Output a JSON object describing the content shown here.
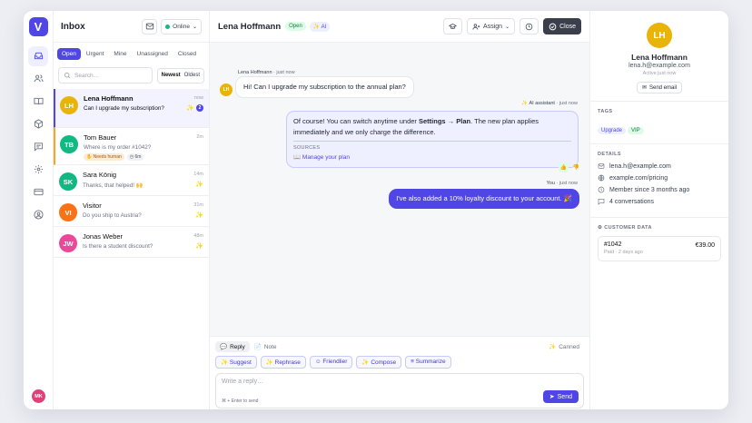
{
  "rail": {
    "logo": "V",
    "avatar": "MK",
    "icons": [
      "inbox-icon",
      "users-icon",
      "book-icon",
      "cube-icon",
      "chat-icon",
      "gear-icon",
      "card-icon",
      "user-circle-icon"
    ]
  },
  "list": {
    "title": "Inbox",
    "status": "Online",
    "tabs": [
      "Open",
      "Urgent",
      "Mine",
      "Unassigned",
      "Closed"
    ],
    "search_placeholder": "Search…",
    "sort": [
      "Newest",
      "Oldest"
    ],
    "conversations": [
      {
        "initials": "LH",
        "name": "Lena Hoffmann",
        "preview": "Can I upgrade my subscription?",
        "time": "now",
        "badge": "2",
        "color": "#eab308"
      },
      {
        "initials": "TB",
        "name": "Tom Bauer",
        "preview": "Where is my order #1042?",
        "time": "2m",
        "tag1": "Needs human",
        "tag2": "6m",
        "color": "#10b981"
      },
      {
        "initials": "SK",
        "name": "Sara König",
        "preview": "Thanks, that helped! 🙌",
        "time": "14m",
        "color": "#10b981"
      },
      {
        "initials": "VI",
        "name": "Visitor",
        "preview": "Do you ship to Austria?",
        "time": "31m",
        "color": "#f97316"
      },
      {
        "initials": "JW",
        "name": "Jonas Weber",
        "preview": "Is there a student discount?",
        "time": "48m",
        "color": "#ec4899"
      }
    ]
  },
  "chat": {
    "name": "Lena Hoffmann",
    "status": "Open",
    "ai_tag": "AI",
    "assign": "Assign",
    "close": "Close",
    "m1_author": "Lena Hoffmann",
    "m1_time": "just now",
    "m1_avatar": "LH",
    "m1_text": "Hi! Can I upgrade my subscription to the annual plan?",
    "m2_author": "AI assistant",
    "m2_time": "just now",
    "m2_pre": "Of course! You can switch anytime under ",
    "m2_b1": "Settings",
    "m2_arrow": " → ",
    "m2_b2": "Plan",
    "m2_post": ". The new plan applies immediately and we only charge the difference.",
    "sources_label": "SOURCES",
    "source_link": "Manage your plan",
    "m3_author": "You",
    "m3_time": "just now",
    "m3_text": "I've also added a 10% loyalty discount to your account. 🎉"
  },
  "composer": {
    "reply": "Reply",
    "note": "Note",
    "canned": "Canned",
    "ai": [
      "Suggest",
      "Rephrase",
      "Friendlier",
      "Compose",
      "Summarize"
    ],
    "placeholder": "Write a reply…",
    "hint": "⌘ + Enter to send",
    "send": "Send"
  },
  "side": {
    "initials": "LH",
    "name": "Lena Hoffmann",
    "email": "lena.h@example.com",
    "active": "Active just now",
    "send_email": "Send email",
    "tags_label": "TAGS",
    "tags": [
      "Upgrade",
      "VIP"
    ],
    "details_label": "DETAILS",
    "details": [
      "lena.h@example.com",
      "example.com/pricing",
      "Member since 3 months ago",
      "4 conversations"
    ],
    "customer_label": "CUSTOMER DATA",
    "order": "#1042",
    "order_status": "Paid · 2 days ago",
    "amount": "€39.00"
  }
}
